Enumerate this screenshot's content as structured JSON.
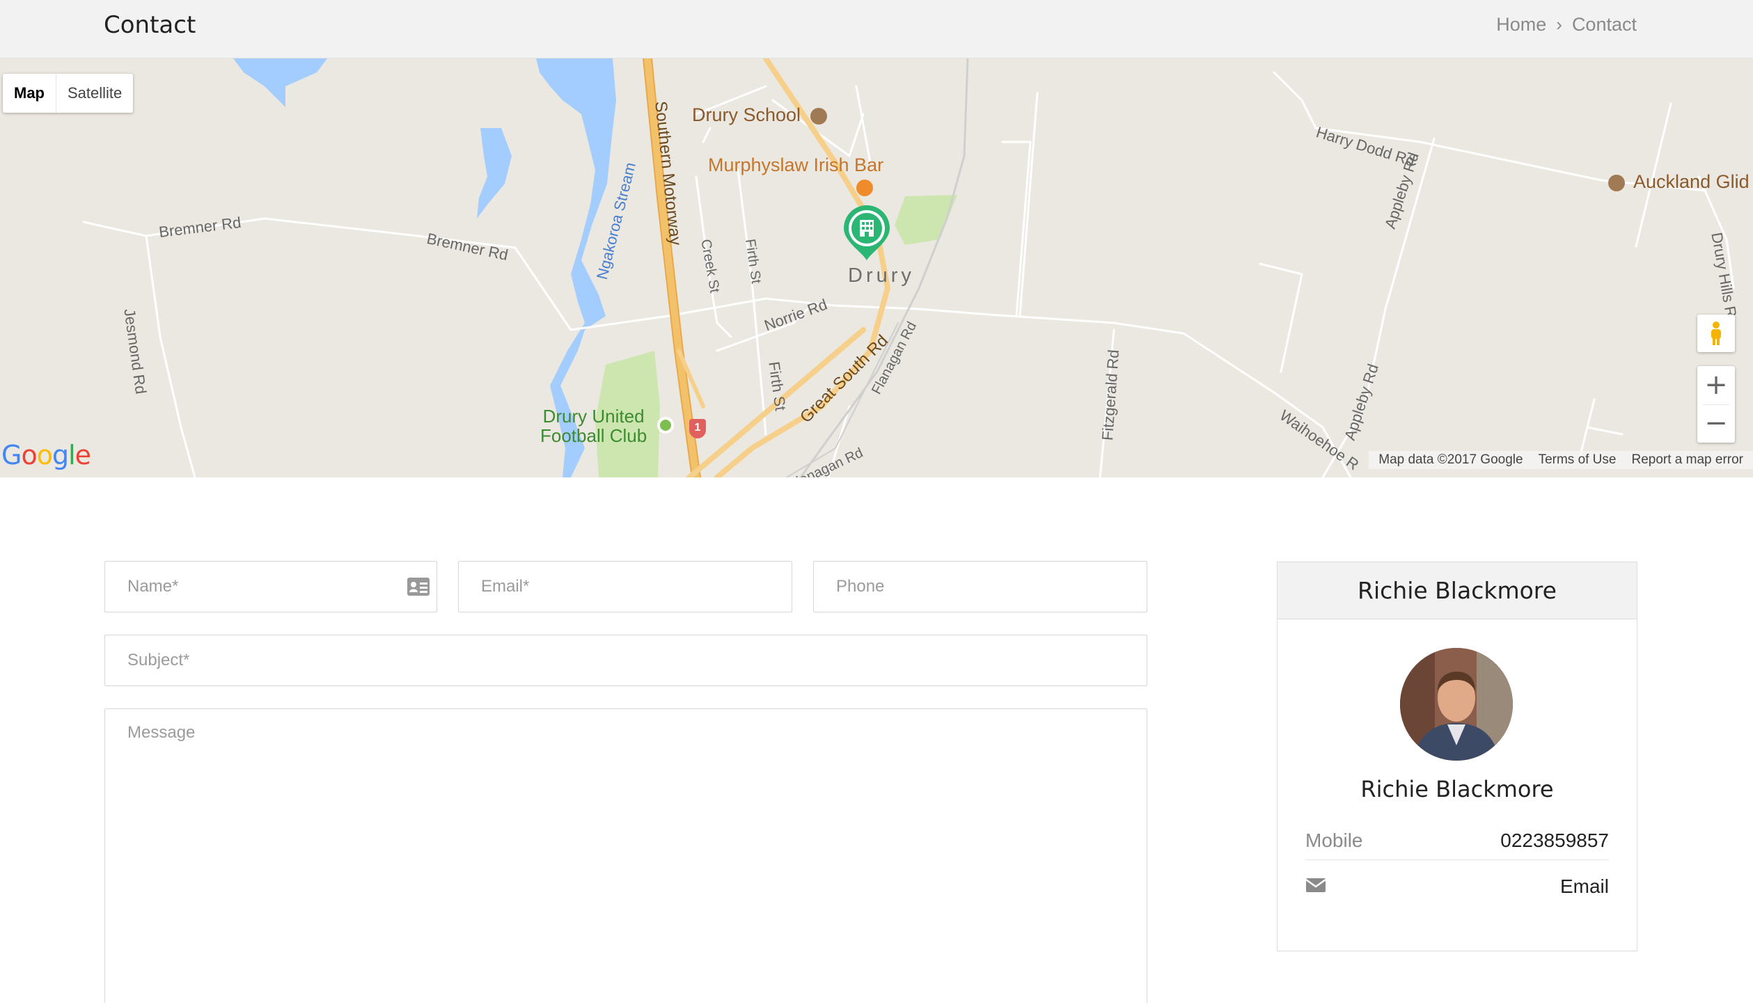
{
  "header": {
    "title": "Contact",
    "breadcrumb": {
      "home": "Home",
      "separator": "›",
      "current": "Contact"
    }
  },
  "map": {
    "type_controls": {
      "map": "Map",
      "satellite": "Satellite",
      "active": "Map"
    },
    "labels": {
      "drury_school": "Drury School",
      "murphyslaw": "Murphyslaw Irish Bar",
      "auckland_glid": "Auckland Glid",
      "harry_dodd": "Harry Dodd Rd",
      "appleby_top": "Appleby Rd",
      "appleby_bottom": "Appleby Rd",
      "bremner_left": "Bremner Rd",
      "bremner_right": "Bremner Rd",
      "jesmond": "Jesmond Rd",
      "ngakoroa": "Ngakoroa Stream",
      "southern_motorway": "Southern Motorway",
      "creek": "Creek St",
      "firth_top": "Firth St",
      "firth_bottom": "Firth St",
      "norrie": "Norrie Rd",
      "drury": "Drury",
      "great_south": "Great South Rd",
      "flanagan_top": "Flanagan Rd",
      "flanagan_bottom": "Flanagan Rd",
      "fitzgerald": "Fitzgerald Rd",
      "waihoehoe": "Waihoehoe R",
      "drury_hills": "Drury Hills R",
      "football_line1": "Drury United",
      "football_line2": "Football Club",
      "shield": "1"
    },
    "zoom_in": "+",
    "zoom_out": "−",
    "logo": "Google",
    "attribution": {
      "data": "Map data ©2017 Google",
      "terms": "Terms of Use",
      "report": "Report a map error"
    },
    "colors": {
      "land": "#ebe8e1",
      "water": "#a3ccff",
      "park": "#cde6b0",
      "motorway": "#f4c16b",
      "marker": "#2bb673"
    }
  },
  "form": {
    "name_placeholder": "Name*",
    "email_placeholder": "Email*",
    "phone_placeholder": "Phone",
    "subject_placeholder": "Subject*",
    "message_placeholder": "Message"
  },
  "agent_card": {
    "header_name": "Richie Blackmore",
    "name": "Richie Blackmore",
    "mobile_label": "Mobile",
    "mobile_value": "0223859857",
    "email_label": "Email"
  }
}
